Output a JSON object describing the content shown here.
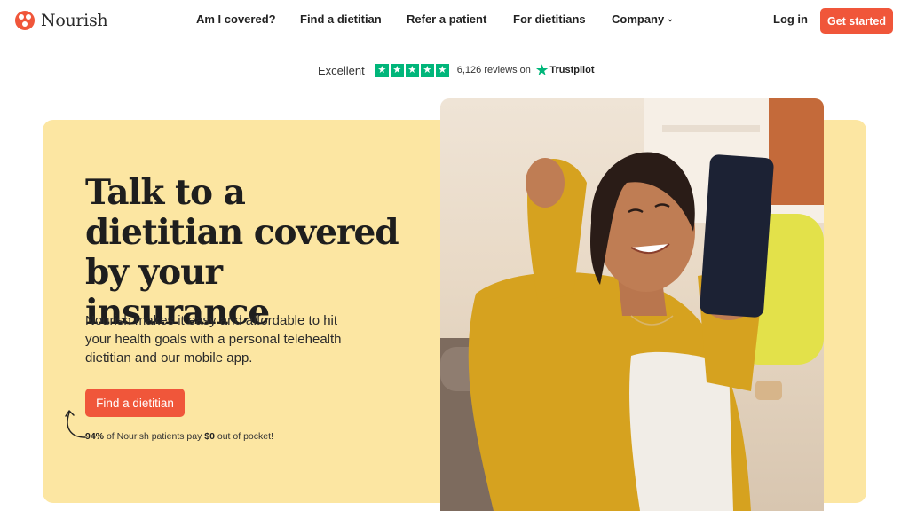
{
  "header": {
    "logo_text": "Nourish",
    "nav": [
      "Am I covered?",
      "Find a dietitian",
      "Refer a patient",
      "For dietitians",
      "Company"
    ],
    "login": "Log in",
    "cta": "Get started"
  },
  "trustpilot": {
    "excellent": "Excellent",
    "reviews": "6,126 reviews on",
    "brand": "Trustpilot",
    "rating": 5
  },
  "hero": {
    "headline": "Talk to a dietitian covered by your insurance",
    "sub": "Nourish makes it easy and affordable to hit your health goals with a personal telehealth dietitian and our mobile app.",
    "button": "Find a dietitian",
    "stat_pct": "94%",
    "stat_mid": "of Nourish patients pay",
    "stat_amt": "$0",
    "stat_end": "out of pocket!"
  },
  "colors": {
    "accent": "#f0563a",
    "hero_bg": "#fce6a2",
    "trustpilot_green": "#00b67a"
  },
  "icons": [
    "nourish-logo-icon",
    "chevron-down-icon",
    "trustpilot-star-icon",
    "curved-arrow-icon"
  ]
}
